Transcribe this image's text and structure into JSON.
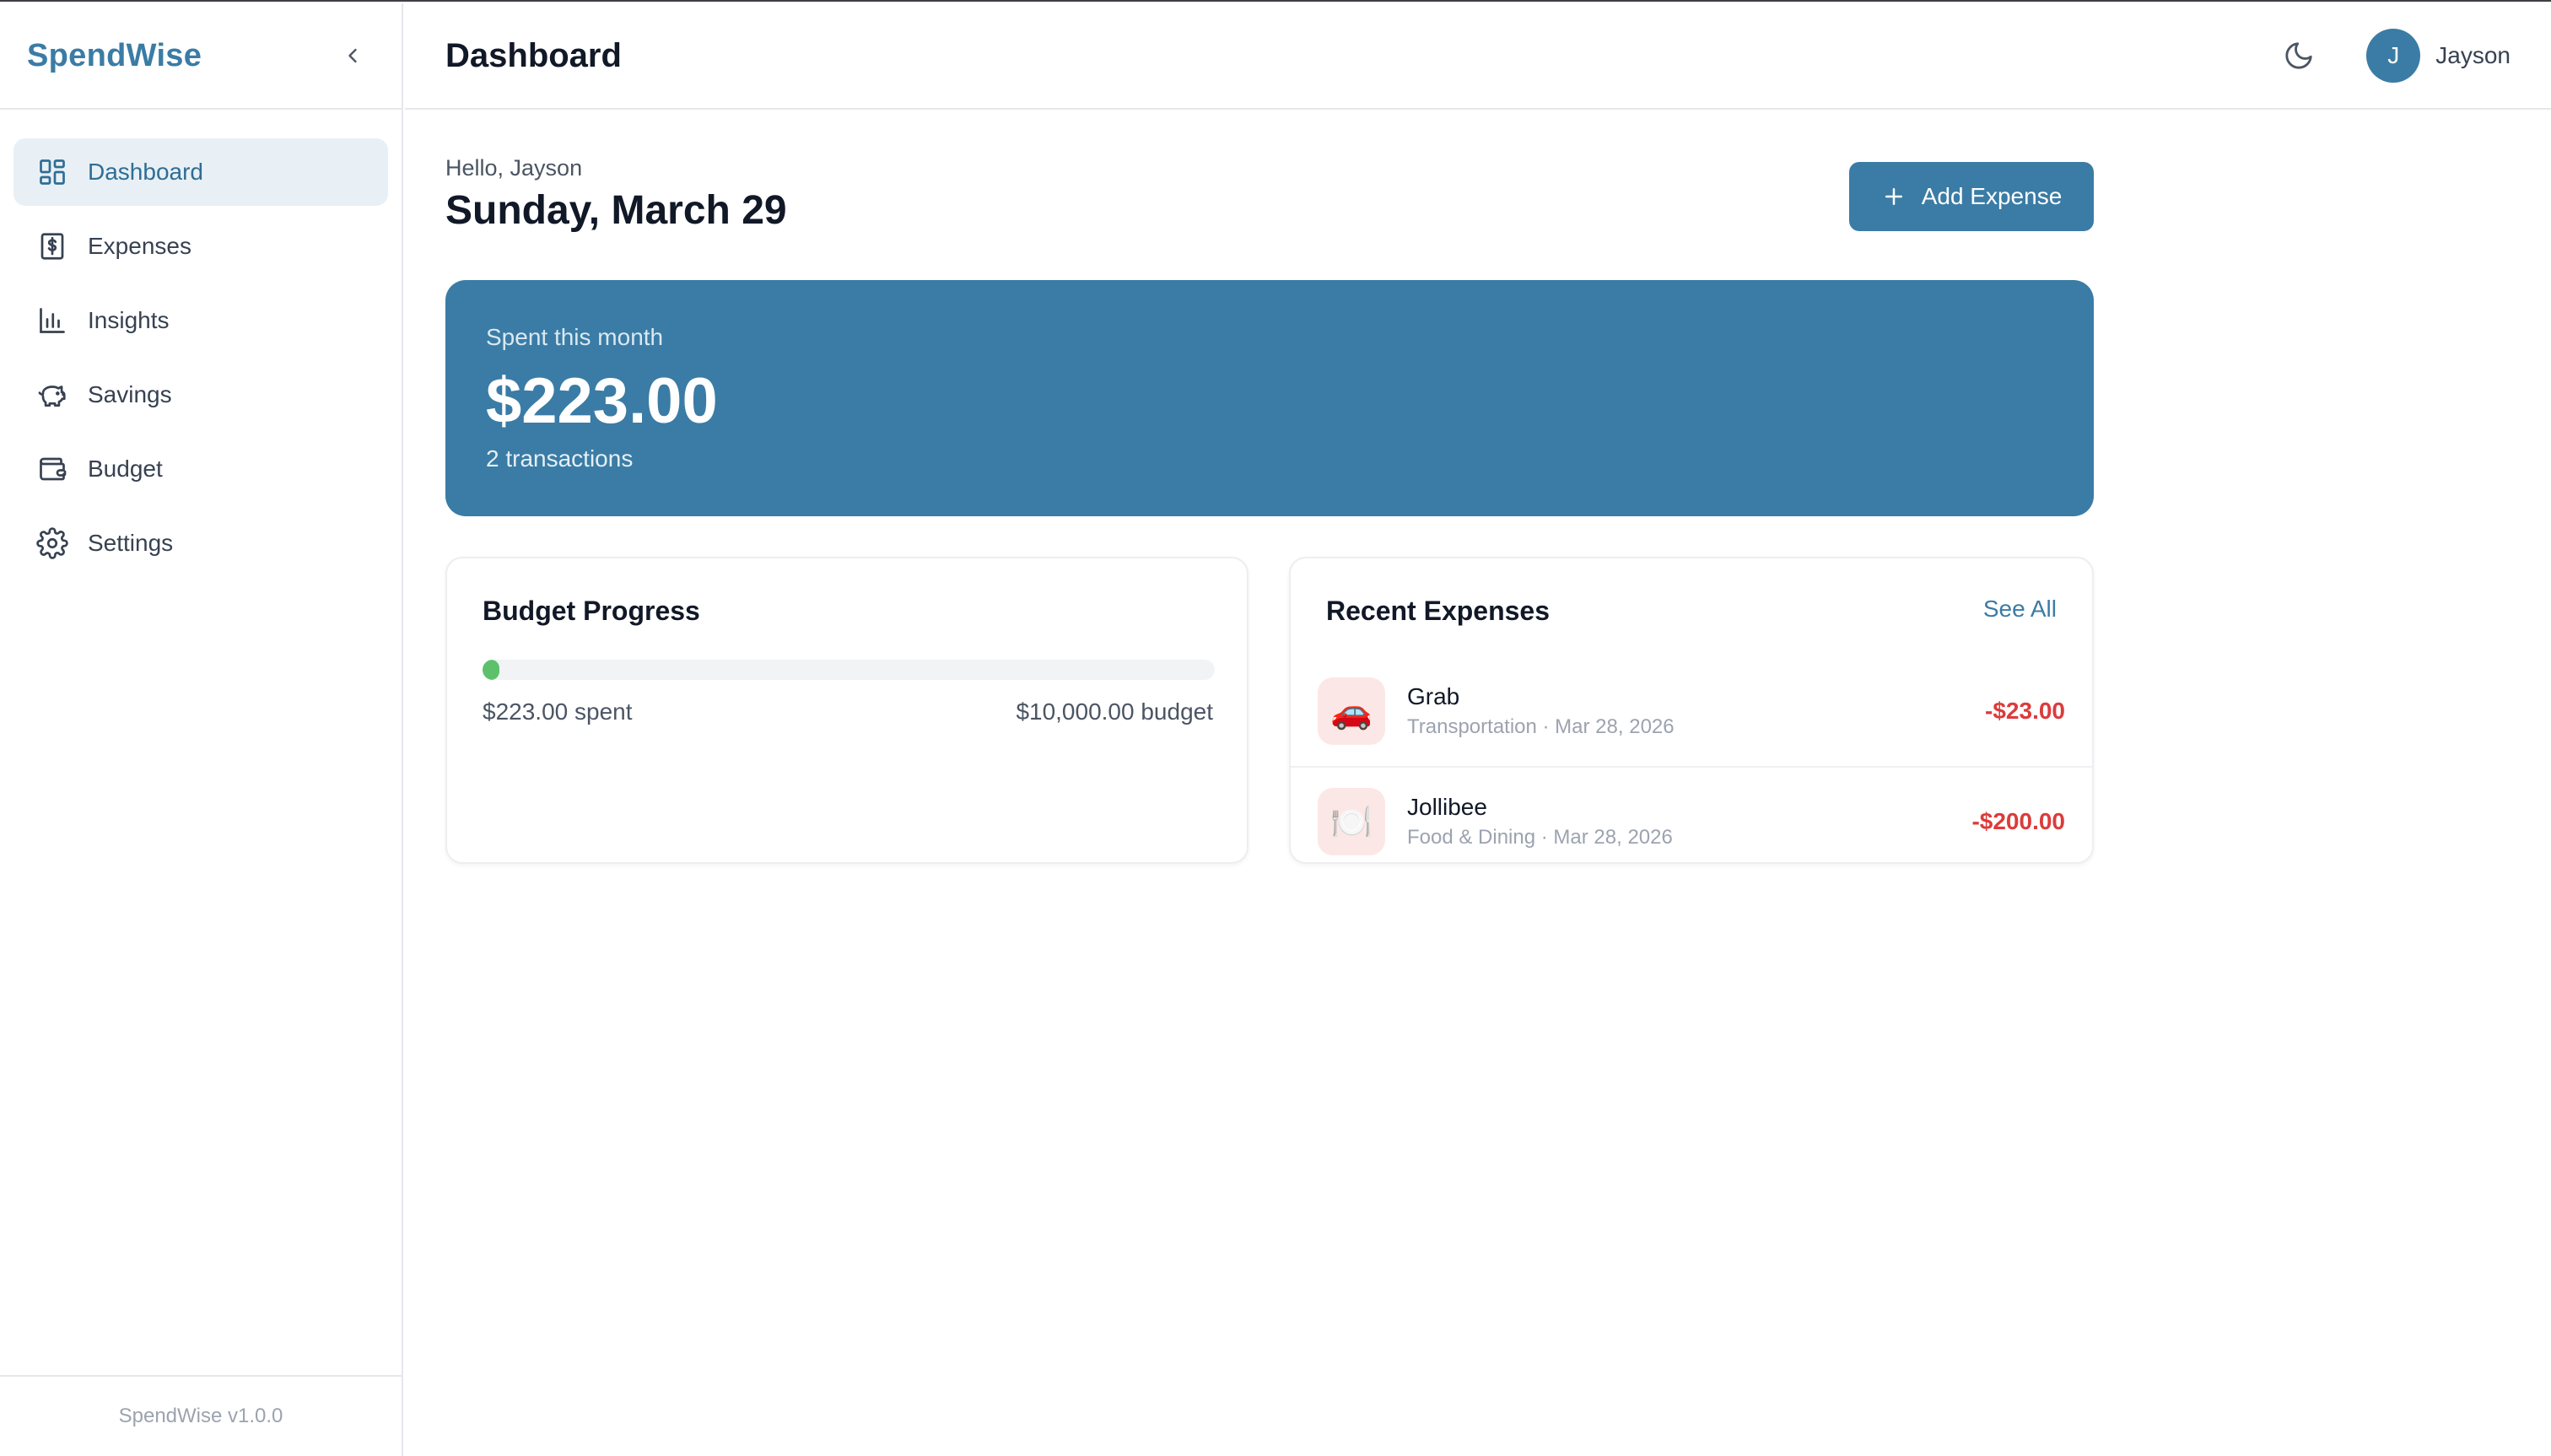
{
  "sidebar": {
    "brand": "SpendWise",
    "items": [
      {
        "label": "Dashboard",
        "icon": "dashboard-grid-icon",
        "active": true
      },
      {
        "label": "Expenses",
        "icon": "receipt-dollar-icon"
      },
      {
        "label": "Insights",
        "icon": "bar-chart-icon"
      },
      {
        "label": "Savings",
        "icon": "piggy-bank-icon"
      },
      {
        "label": "Budget",
        "icon": "wallet-icon"
      },
      {
        "label": "Settings",
        "icon": "gear-icon"
      }
    ],
    "footer": "SpendWise v1.0.0"
  },
  "header": {
    "title": "Dashboard",
    "avatar_initial": "J",
    "user_name": "Jayson"
  },
  "greeting": {
    "hello": "Hello, Jayson",
    "date": "Sunday, March 29",
    "add_button": "Add Expense"
  },
  "summary": {
    "label": "Spent this month",
    "amount": "$223.00",
    "transactions": "2 transactions"
  },
  "budget": {
    "title": "Budget Progress",
    "spent_label": "$223.00 spent",
    "budget_label": "$10,000.00 budget",
    "progress_fraction": 0.0223
  },
  "recent": {
    "title": "Recent Expenses",
    "see_all": "See All",
    "items": [
      {
        "name": "Grab",
        "meta": "Transportation · Mar 28, 2026",
        "amount": "-$23.00",
        "icon": "🚗"
      },
      {
        "name": "Jollibee",
        "meta": "Food & Dining · Mar 28, 2026",
        "amount": "-$200.00",
        "icon": "🍽️"
      }
    ]
  },
  "colors": {
    "accent": "#3a7ca5",
    "active_bg": "#e8f0f5",
    "negative": "#dc3b3b",
    "progress": "#5cc16a"
  }
}
